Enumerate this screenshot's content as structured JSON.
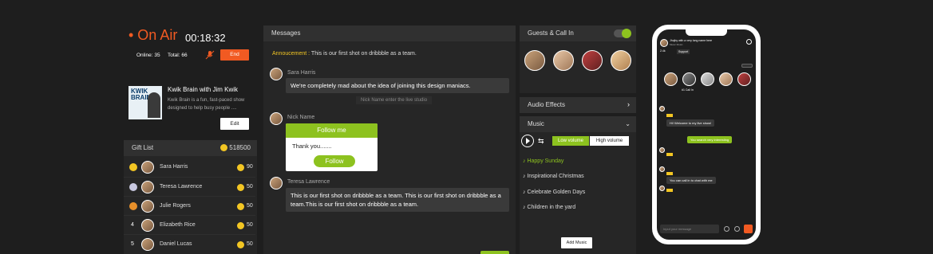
{
  "onair": {
    "label": "• On Air",
    "timer": "00:18:32",
    "online": "Online: 35",
    "total": "Total: 66",
    "end_label": "End"
  },
  "show": {
    "title": "Kwik Brain with Jim Kwik",
    "desc": "Kwik Brain is a fun, fast-paced show designed to help busy people ....",
    "edit_label": "Edit",
    "cover_text": "KWIK BRAIN"
  },
  "gifts": {
    "title": "Gift List",
    "total": "518500",
    "rows": [
      {
        "rank": "",
        "name": "Sara Harris",
        "value": "90"
      },
      {
        "rank": "",
        "name": "Teresa Lawrence",
        "value": "50"
      },
      {
        "rank": "",
        "name": "Julie Rogers",
        "value": "50"
      },
      {
        "rank": "4",
        "name": "Elizabeth Rice",
        "value": "50"
      },
      {
        "rank": "5",
        "name": "Daniel Lucas",
        "value": "50"
      }
    ]
  },
  "messages": {
    "title": "Messages",
    "announcement_label": "Annoucement :",
    "announcement_text": "This is our first shot on dribbble as a team.",
    "m1_name": "Sara Harris",
    "m1_text": "We're completely mad about the idea of joining this design maniacs.",
    "system": "Nick Name enter the live studio",
    "m2_name": "Nick Name",
    "follow_header": "Follow me",
    "follow_text": "Thank you.......",
    "follow_btn": "Follow",
    "m3_name": "Teresa Lawrence",
    "m3_text": "This is our first shot on dribbble as a team. This is our first shot on dribbble as a team.This is our first shot on dribbble as a team."
  },
  "guests": {
    "title": "Guests & Call In"
  },
  "audio": {
    "title": "Audio Effects"
  },
  "music": {
    "title": "Music",
    "low": "Low volume",
    "high": "High volume",
    "tracks": [
      "Happy Sunday",
      "Inspirational Christmas",
      "Celebrate Golden Days",
      "Children in the yard"
    ],
    "add_label": "Add Music"
  },
  "phone": {
    "header": "Jhojhy with a very long name here",
    "sub": "Music Music",
    "tag1": "2.4k",
    "tag2": "Support",
    "hashtag": "#1 Call In",
    "chat1": "Hi! Welcome to my live show!",
    "chat2": "You search very interesting",
    "chat3": "You can call in to chat with me",
    "input": "Input your message"
  },
  "colors": {
    "accent": "#f15a22",
    "green": "#8dc21f",
    "gold": "#f3c623"
  }
}
